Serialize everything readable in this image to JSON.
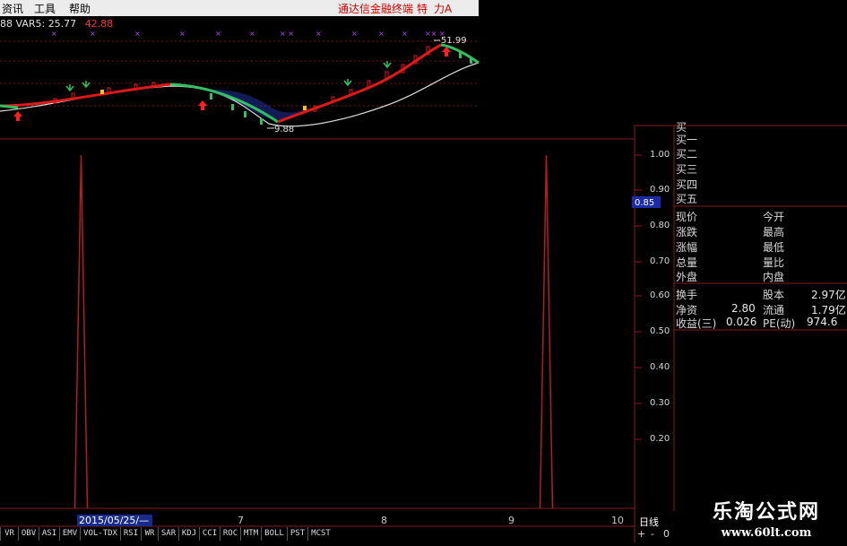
{
  "menu": {
    "items": [
      "资讯",
      "工具",
      "帮助"
    ],
    "promo": "通达信金融终端",
    "right_a": "特",
    "right_b": "力A"
  },
  "indicator_row": {
    "a": "88 VAR5:",
    "b": "25.77",
    "c": "42.88"
  },
  "price_chart": {
    "high_label": "51.99",
    "low_label": "9.88"
  },
  "y_axis": {
    "labels": [
      "1.00",
      "0.90",
      "0.80",
      "0.70",
      "0.60",
      "0.50",
      "0.40",
      "0.30",
      "0.20"
    ],
    "current": "0.85"
  },
  "quote_panel": {
    "orders": [
      "买",
      "买一",
      "买二",
      "买三",
      "买四",
      "买五"
    ],
    "rows": [
      {
        "l": "现价",
        "m": "今开",
        "v": ""
      },
      {
        "l": "涨跌",
        "m": "最高",
        "v": ""
      },
      {
        "l": "涨幅",
        "m": "最低",
        "v": ""
      },
      {
        "l": "总量",
        "m": "量比",
        "v": ""
      },
      {
        "l": "外盘",
        "m": "内盘",
        "v": ""
      }
    ],
    "fin_rows": [
      {
        "l": "换手",
        "a": "",
        "m": "股本",
        "v": "2.97亿"
      },
      {
        "l": "净资",
        "a": "2.80",
        "m": "流通",
        "v": "1.79亿"
      },
      {
        "l": "收益(三)",
        "a": "0.026",
        "m": "PE(动)",
        "v": "974.6"
      }
    ]
  },
  "x_axis": {
    "date": "2015/05/25/—",
    "ticks": [
      "7",
      "8",
      "9",
      "10"
    ]
  },
  "period": "日线",
  "tabs": [
    "VR",
    "OBV",
    "ASI",
    "EMV",
    "VOL-TDX",
    "RSI",
    "WR",
    "SAR",
    "KDJ",
    "CCI",
    "ROC",
    "MTM",
    "BOLL",
    "PST",
    "MCST"
  ],
  "controls": [
    "+",
    "-",
    "0"
  ],
  "watermark": {
    "name": "乐淘公式网",
    "url": "www.60lt.com"
  },
  "chart_data": {
    "type": "line",
    "ylim": [
      0,
      1.05
    ],
    "series": [
      {
        "values": [
          0,
          0,
          1.0,
          0,
          0,
          0,
          0,
          0,
          0,
          0,
          0,
          0,
          0,
          0,
          1.0,
          0,
          0
        ]
      }
    ]
  },
  "colors": {
    "grid_red": "#8b1a1a",
    "signal": "#b02020",
    "ma_red": "#e01818",
    "ma_green": "#30c060",
    "ma_white": "#d8d8d8",
    "blue_band": "#2a3cc0"
  }
}
